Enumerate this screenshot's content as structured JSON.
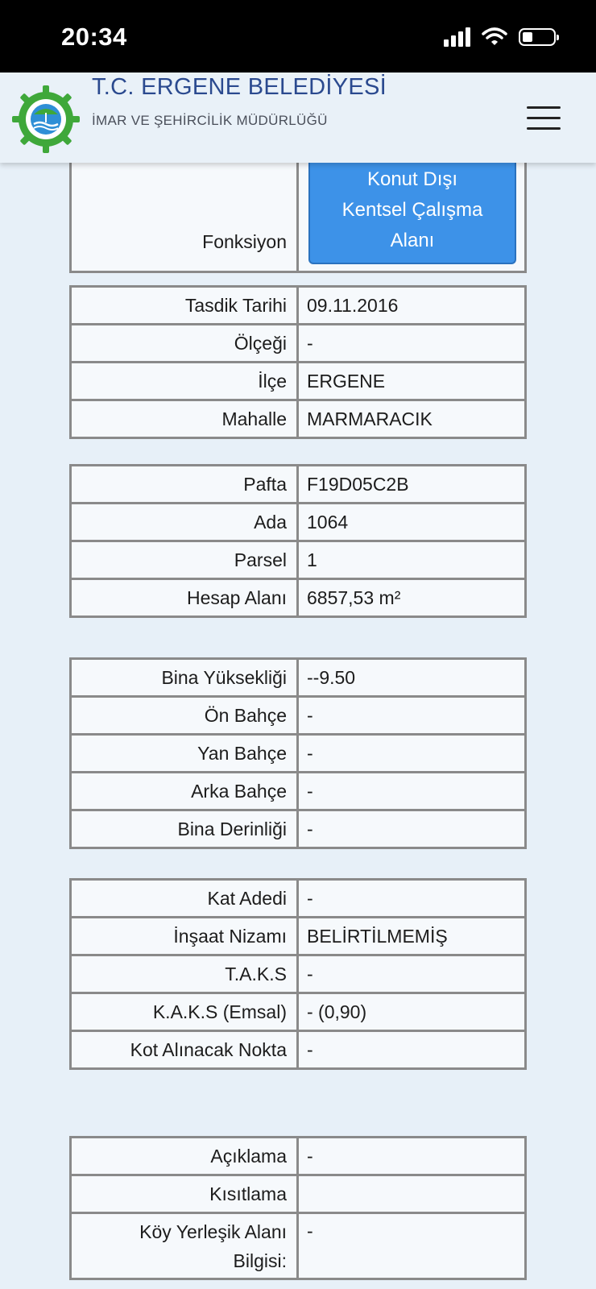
{
  "status_bar": {
    "time": "20:34"
  },
  "header": {
    "title": "T.C. ERGENE BELEDİYESİ",
    "subtitle": "İMAR VE ŞEHİRCİLİK MÜDÜRLÜĞÜ"
  },
  "function_row": {
    "label": "Fonksiyon",
    "value_lines": [
      "Konut Dışı",
      "Kentsel Çalışma",
      "Alanı"
    ]
  },
  "group1": [
    {
      "label": "Tasdik Tarihi",
      "value": "09.11.2016"
    },
    {
      "label": "Ölçeği",
      "value": "-"
    },
    {
      "label": "İlçe",
      "value": "ERGENE"
    },
    {
      "label": "Mahalle",
      "value": "MARMARACIK"
    }
  ],
  "group2": [
    {
      "label": "Pafta",
      "value": "F19D05C2B"
    },
    {
      "label": "Ada",
      "value": "1064"
    },
    {
      "label": "Parsel",
      "value": "1"
    },
    {
      "label": "Hesap Alanı",
      "value": "6857,53 m²"
    }
  ],
  "group3": [
    {
      "label": "Bina Yüksekliği",
      "value": "--9.50"
    },
    {
      "label": "Ön Bahçe",
      "value": "-"
    },
    {
      "label": "Yan Bahçe",
      "value": "-"
    },
    {
      "label": "Arka Bahçe",
      "value": "-"
    },
    {
      "label": "Bina Derinliği",
      "value": "-"
    }
  ],
  "group4": [
    {
      "label": "Kat Adedi",
      "value": "-"
    },
    {
      "label": "İnşaat Nizamı",
      "value": "BELİRTİLMEMİŞ"
    },
    {
      "label": "T.A.K.S",
      "value": "-"
    },
    {
      "label": "K.A.K.S (Emsal)",
      "value": "- (0,90)"
    },
    {
      "label": "Kot Alınacak Nokta",
      "value": "-"
    }
  ],
  "group5": [
    {
      "label": "Açıklama",
      "value": "-"
    },
    {
      "label": "Kısıtlama",
      "value": ""
    },
    {
      "label_lines": [
        "Köy Yerleşik Alanı",
        "Bilgisi:"
      ],
      "value": "-"
    }
  ],
  "colors": {
    "header_title": "#2b4a8f",
    "function_badge": "#3d92e8",
    "page_background": "#e7f0f8",
    "table_border": "#8a8a8a"
  },
  "icons": {
    "logo": "municipality-seal-icon",
    "menu": "hamburger-menu-icon",
    "signal": "cellular-signal-icon",
    "wifi": "wifi-icon",
    "battery": "battery-icon"
  }
}
